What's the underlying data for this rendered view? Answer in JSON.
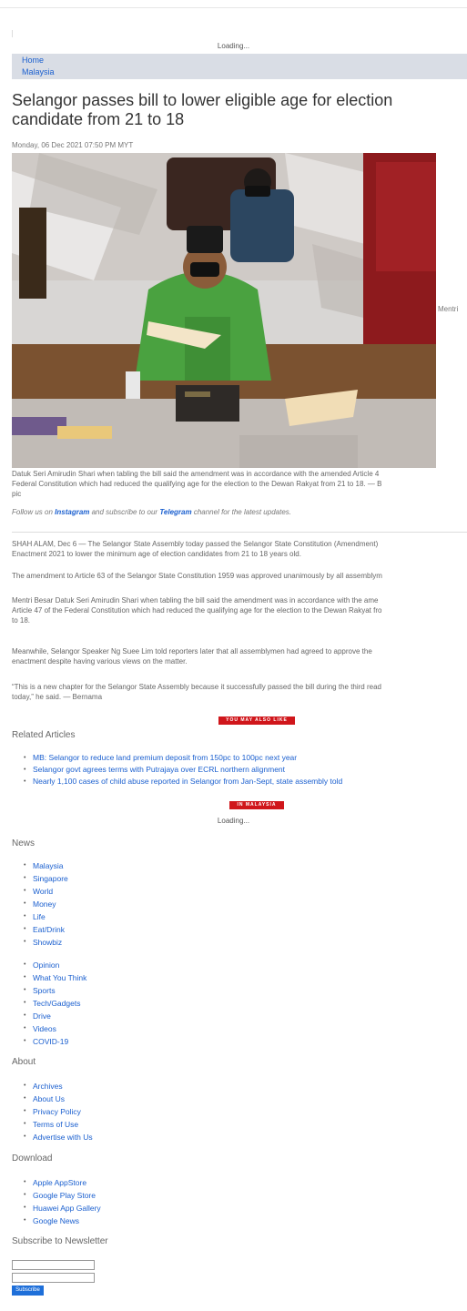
{
  "loading_top": "Loading...",
  "breadcrumb": {
    "home": "Home",
    "section": "Malaysia"
  },
  "article": {
    "title": "Selangor passes bill to lower eligible age for election candidate from 21 to 18",
    "date": "Monday, 06 Dec 2021 07:50 PM MYT",
    "side_text": "Mentri",
    "caption_line1": "Datuk Seri Amirudin Shari when tabling the bill said the amendment was in accordance with the amended Article 4",
    "caption_line2": "Federal Constitution which had reduced the qualifying age for the election to the Dewan Rakyat from 21 to 18. — B",
    "caption_line3": "pic",
    "follow_prefix": "Follow us on ",
    "follow_instagram": "Instagram",
    "follow_middle": " and subscribe to our ",
    "follow_telegram": "Telegram",
    "follow_suffix": " channel for the latest updates.",
    "p1_line1": "SHAH ALAM, Dec 6 — The Selangor State Assembly today passed the Selangor State Constitution (Amendment)",
    "p1_line2": "Enactment 2021 to lower the minimum age of election candidates from 21 to 18 years old.",
    "p2_line1": "The amendment to Article 63 of the Selangor State Constitution 1959 was approved unanimously by all assemblym",
    "p3_line1": "Mentri Besar Datuk Seri Amirudin Shari when tabling the bill said the amendment was in accordance with the ame",
    "p3_line2": "Article 47 of the Federal Constitution which had reduced the qualifying age for the election to the Dewan Rakyat fro",
    "p3_line3": "to 18.",
    "p4_line1": "Meanwhile, Selangor Speaker Ng Suee Lim told reporters later that all assemblymen had agreed to approve the",
    "p4_line2": "enactment despite having various views on the matter.",
    "p5_line1": "“This is a new chapter for the Selangor State Assembly because it successfully passed the bill during the third read",
    "p5_line2": "today,” he said. — Bernama"
  },
  "you_may_also_like": "YOU MAY ALSO LIKE",
  "related": {
    "heading": "Related Articles",
    "items": [
      "MB: Selangor to reduce land premium deposit from 150pc to 100pc next year",
      "Selangor govt agrees terms with Putrajaya over ECRL northern alignment",
      "Nearly 1,100 cases of child abuse reported in Selangor from Jan-Sept, state assembly told"
    ]
  },
  "in_malaysia": "IN MALAYSIA",
  "loading_mid": "Loading...",
  "footer": {
    "news_heading": "News",
    "news_items": [
      "Malaysia",
      "Singapore",
      "World",
      "Money",
      "Life",
      "Eat/Drink",
      "Showbiz"
    ],
    "news_items2": [
      "Opinion",
      "What You Think",
      "Sports",
      "Tech/Gadgets",
      "Drive",
      "Videos",
      "COVID-19"
    ],
    "about_heading": "About",
    "about_items": [
      "Archives",
      "About Us",
      "Privacy Policy",
      "Terms of Use",
      "Advertise with Us"
    ],
    "download_heading": "Download",
    "download_items": [
      "Apple AppStore",
      "Google Play Store",
      "Huawei App Gallery",
      "Google News"
    ],
    "newsletter_heading": "Subscribe to Newsletter",
    "subscribe_label": "Subscribe"
  },
  "colors": {
    "link": "#1a5fcf",
    "red_tag": "#d0161b",
    "subscribe": "#1e6fd9",
    "breadcrumb_bg": "#d9dde5"
  }
}
